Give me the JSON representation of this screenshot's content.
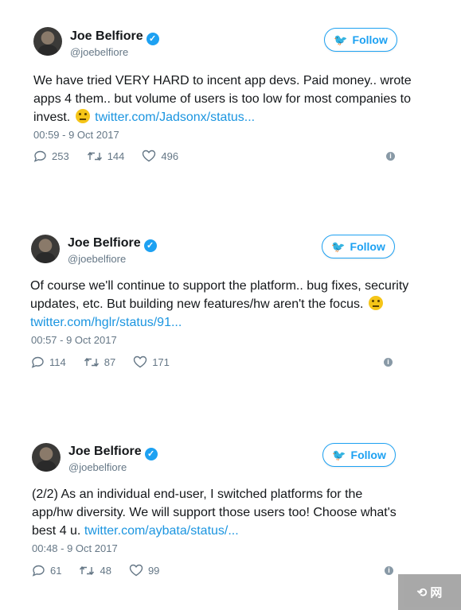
{
  "tweets": [
    {
      "name": "Joe Belfiore",
      "handle": "@joebelfiore",
      "follow_label": "Follow",
      "text_before": "We have tried VERY HARD to incent app devs. Paid money.. wrote apps 4 them.. but volume of users is too low for most companies to invest.",
      "emoji": "confused-face",
      "link": "twitter.com/Jadsonx/status...",
      "time": "00:59 - 9 Oct 2017",
      "replies": "253",
      "retweets": "144",
      "likes": "496"
    },
    {
      "name": "Joe Belfiore",
      "handle": "@joebelfiore",
      "follow_label": "Follow",
      "text_before": "Of course we'll continue to support the platform.. bug fixes, security updates, etc. But building new features/hw aren't the focus.",
      "emoji": "worried-face",
      "link": "twitter.com/hglr/status/91...",
      "time": "00:57 - 9 Oct 2017",
      "replies": "114",
      "retweets": "87",
      "likes": "171"
    },
    {
      "name": "Joe Belfiore",
      "handle": "@joebelfiore",
      "follow_label": "Follow",
      "text_before": "(2/2) As an individual end-user, I switched platforms for the app/hw diversity. We will support those users too! Choose what's best 4 u.",
      "emoji": "",
      "link": "twitter.com/aybata/status/...",
      "time": "00:48 - 9 Oct 2017",
      "replies": "61",
      "retweets": "48",
      "likes": "99"
    }
  ],
  "colors": {
    "brand": "#1da1f2",
    "link": "#1b95e0",
    "muted": "#657786"
  }
}
